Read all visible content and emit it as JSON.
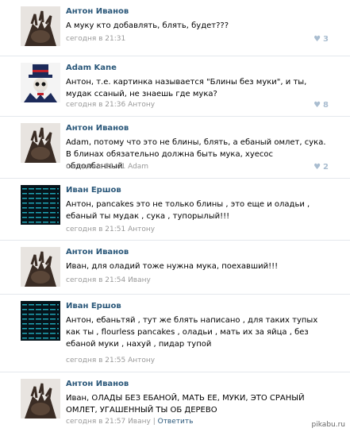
{
  "comments": [
    {
      "author": "Антон Иванов",
      "text": "А муку кто добавлять, блять, будет???",
      "meta": "сегодня в 21:31",
      "likes": "3",
      "avatar": "anton-avatar"
    },
    {
      "author": "Adam Kane",
      "text": "Антон, т.е. картинка называется \"Блины без муки\", и ты, мудак ссаный, не знаешь где мука?",
      "meta": "сегодня в 21:36 Антону",
      "likes": "8",
      "avatar": "adam-avatar"
    },
    {
      "author": "Антон Иванов",
      "text": "Adam, потому что это не блины, блять, а ебаный омлет, сука. В блинах обязательно должна быть мука, хуесос обдолбанный",
      "meta": "сегодня в 21:41 Adam",
      "likes": "2",
      "avatar": "anton-avatar"
    },
    {
      "author": "Иван Ершов",
      "text": "Антон, pancakes это не только блины , это еще и оладьи , ебаный ты мудак , сука , тупорылый!!!",
      "meta": "сегодня в 21:51 Антону",
      "likes": "",
      "avatar": "ivan-avatar"
    },
    {
      "author": "Антон Иванов",
      "text": "Иван, для оладий тоже нужна мука, поехавший!!!",
      "meta": "сегодня в 21:54 Ивану",
      "likes": "",
      "avatar": "anton-avatar"
    },
    {
      "author": "Иван Ершов",
      "text": "Антон, ебаньтяй , тут же блять написано , для таких тупых как ты , flourless pancakes , оладьи , мать их за яйца , без ебаной муки , нахуй , пидар тупой",
      "meta": "сегодня в 21:55 Антону",
      "likes": "",
      "avatar": "ivan-avatar"
    },
    {
      "author": "Антон Иванов",
      "text": "Иван, ОЛАДЫ БЕЗ ЕБАНОЙ, МАТЬ ЕЕ, МУКИ, ЭТО СРАНЫЙ ОМЛЕТ, УГАШЕННЫЙ ТЫ ОБ ДЕРЕВО",
      "meta": "сегодня в 21:57 Ивану",
      "reply": "Ответить",
      "likes": "",
      "avatar": "anton-avatar"
    }
  ],
  "watermark": "pikabu.ru",
  "colors": {
    "author": "#2b587a",
    "meta": "#999999",
    "like": "#a9bdd0",
    "divider": "#e4e8ed"
  }
}
